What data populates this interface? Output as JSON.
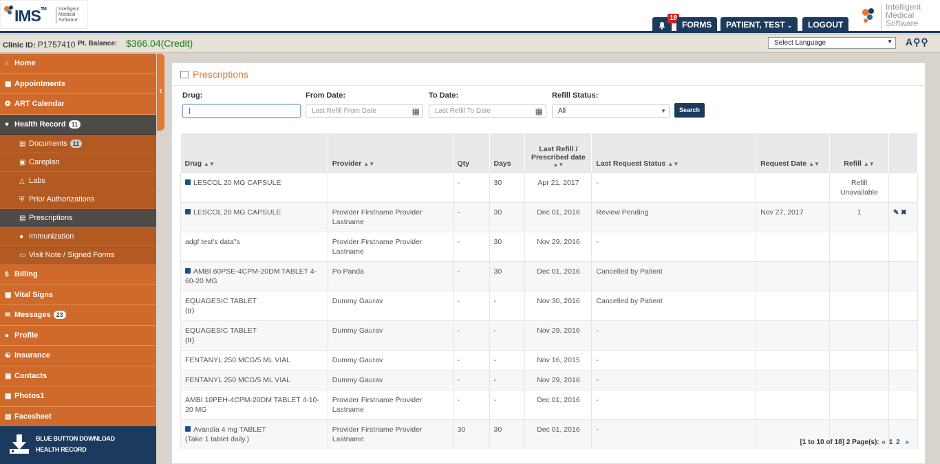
{
  "header": {
    "logo_text": "IMS",
    "logo_tm": "TM",
    "logo_sub": [
      "Intelligent",
      "Medical",
      "Software"
    ],
    "notification_count": "18",
    "forms_label": "FORMS",
    "patient_label": "PATIENT, TEST",
    "logout_label": "LOGOUT",
    "right_logo": [
      "Intelligent",
      "Medical",
      "Software"
    ]
  },
  "clinic": {
    "clinic_id_label": "Clinic ID:",
    "clinic_id": "P1757410",
    "balance_label": "Pt. Balance:",
    "balance": "$366.04(Credit)",
    "language": "Select Language"
  },
  "sidebar": {
    "home": "Home",
    "appointments": "Appointments",
    "art_calendar": "ART Calendar",
    "health_record": "Health Record",
    "health_record_count": "11",
    "documents": "Documents",
    "documents_count": "11",
    "careplan": "Careplan",
    "labs": "Labs",
    "prior_auth": "Prior Authorizations",
    "prescriptions": "Prescriptions",
    "immunization": "Immunization",
    "visit_note": "Visit Note / Signed Forms",
    "billing": "Billing",
    "vital_signs": "Vital Signs",
    "messages": "Messages",
    "messages_count": "23",
    "profile": "Profile",
    "insurance": "Insurance",
    "contacts": "Contacts",
    "photos": "Photos1",
    "facesheet": "Facesheet",
    "blue_button_1": "BLUE BUTTON DOWNLOAD",
    "blue_button_2": "HEALTH RECORD"
  },
  "page": {
    "title": "Prescriptions",
    "drug_label": "Drug:",
    "drug_value": "|",
    "from_label": "From Date:",
    "from_placeholder": "Last Refill From Date",
    "to_label": "To Date:",
    "to_placeholder": "Last Refill To Date",
    "refill_label": "Refill Status:",
    "refill_value": "All",
    "search_label": "Search"
  },
  "table": {
    "headers": {
      "drug": "Drug",
      "provider": "Provider",
      "qty": "Qty",
      "days": "Days",
      "last_refill_1": "Last Refill /",
      "last_refill_2": "Prescribed date",
      "status": "Last Request Status",
      "request_date": "Request Date",
      "refill": "Refill"
    },
    "rows": [
      {
        "drug": "LESCOL 20 MG CAPSULE",
        "drug2": "",
        "provider": "",
        "qty": "-",
        "days": "30",
        "date": "Apr 21, 2017",
        "status": "-",
        "req": "",
        "refill": "Refill Unavailable",
        "icon": true
      },
      {
        "drug": "LESCOL 20 MG CAPSULE",
        "drug2": "",
        "provider": "Provider Firstname Provider Lastname",
        "qty": "-",
        "days": "30",
        "date": "Dec 01, 2016",
        "status": "Review Pending",
        "req": "Nov 27, 2017",
        "refill": "1",
        "icon": true
      },
      {
        "drug": "adgf test's data\"s",
        "drug2": "",
        "provider": "Provider Firstname Provider Lastname",
        "qty": "-",
        "days": "30",
        "date": "Nov 29, 2016",
        "status": "-",
        "req": "",
        "refill": "",
        "icon": false
      },
      {
        "drug": "AMBI 60PSE-4CPM-20DM TABLET 4-60-20 MG",
        "drug2": "",
        "provider": "Po Panda",
        "qty": "-",
        "days": "30",
        "date": "Dec 01, 2016",
        "status": "Cancelled by Patient",
        "req": "",
        "refill": "",
        "icon": true
      },
      {
        "drug": "EQUAGESIC TABLET",
        "drug2": "(tr)",
        "provider": "Dummy Gaurav",
        "qty": "-",
        "days": "-",
        "date": "Nov 30, 2016",
        "status": "Cancelled by Patient",
        "req": "",
        "refill": "",
        "icon": false
      },
      {
        "drug": "EQUAGESIC TABLET",
        "drug2": "(tr)",
        "provider": "Dummy Gaurav",
        "qty": "-",
        "days": "-",
        "date": "Nov 29, 2016",
        "status": "-",
        "req": "",
        "refill": "",
        "icon": false
      },
      {
        "drug": "FENTANYL 250 MCG/5 ML VIAL",
        "drug2": "",
        "provider": "Dummy Gaurav",
        "qty": "-",
        "days": "-",
        "date": "Nov 16, 2015",
        "status": "-",
        "req": "",
        "refill": "",
        "icon": false
      },
      {
        "drug": "FENTANYL 250 MCG/5 ML VIAL",
        "drug2": "",
        "provider": "Dummy Gaurav",
        "qty": "-",
        "days": "-",
        "date": "Nov 29, 2016",
        "status": "-",
        "req": "",
        "refill": "",
        "icon": false
      },
      {
        "drug": "AMBI 10PEH-4CPM-20DM TABLET 4-10-20 MG",
        "drug2": "",
        "provider": "Provider Firstname Provider Lastname",
        "qty": "-",
        "days": "-",
        "date": "Dec 01, 2016",
        "status": "-",
        "req": "",
        "refill": "",
        "icon": false
      },
      {
        "drug": "Avandia 4 mg TABLET",
        "drug2": "(Take 1 tablet daily.)",
        "provider": "Provider Firstname Provider Lastname",
        "qty": "30",
        "days": "30",
        "date": "Dec 01, 2016",
        "status": "-",
        "req": "",
        "refill": "",
        "icon": true
      }
    ]
  },
  "pager": {
    "summary": "[1 to 10 of 18] 2 Page(s):",
    "prev": "«",
    "p1": "1",
    "p2": "2",
    "next": "»"
  }
}
